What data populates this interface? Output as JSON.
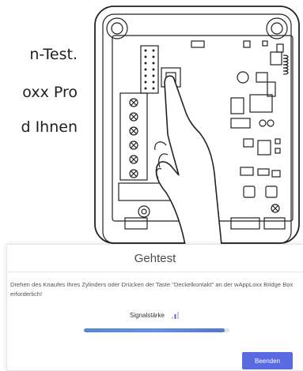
{
  "background_text": {
    "line1": "n-Test.",
    "line2": "oxx Pro",
    "line3": "d Ihnen"
  },
  "dialog": {
    "title": "Gehtest",
    "message": "Drehen des Knaufes Ihres Zylinders oder Drücken der Taste \"Deckelkontakt\" an der wAppLoxx Bridge Box erforderlich!",
    "signal_label": "Signalstärke",
    "signal_icon": "signal-bars-icon",
    "progress_fraction": 0.97,
    "end_button_label": "Beenden",
    "accent_color": "#5a6ae0"
  }
}
